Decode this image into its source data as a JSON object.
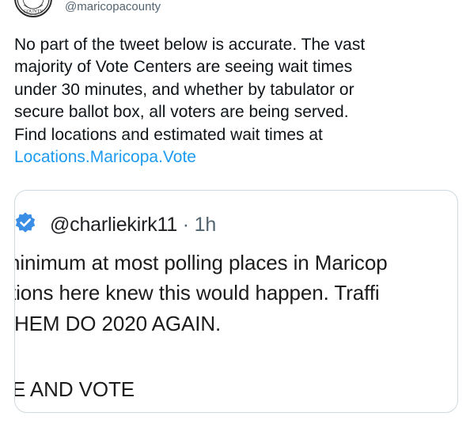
{
  "tweet": {
    "handle": "@maricopacounty",
    "avatar_label": "COUNTY",
    "text_lines": [
      "No part of the tweet below is accurate. The vast",
      "majority of Vote Centers are seeing wait times",
      "under 30 minutes, and whether by tabulator or",
      "secure ballot box, all voters are being served.",
      "Find locations and estimated wait times at"
    ],
    "link_text": "Locations.Maricopa.Vote"
  },
  "quote": {
    "author_handle": "@charliekirk11",
    "meta": " · 1h",
    "lines": [
      "ninimum at most polling places in Maricop",
      "tions here knew this would happen. Traffi",
      "HEM DO 2020 AGAIN.",
      "E AND VOTE"
    ]
  },
  "colors": {
    "link": "#1d9bf0",
    "verified_badge": "#3a8ee6",
    "border": "#cfd9de",
    "secondary_text": "#536471"
  },
  "icons": {
    "avatar": "county-seal-icon",
    "verified": "verified-badge-icon"
  }
}
